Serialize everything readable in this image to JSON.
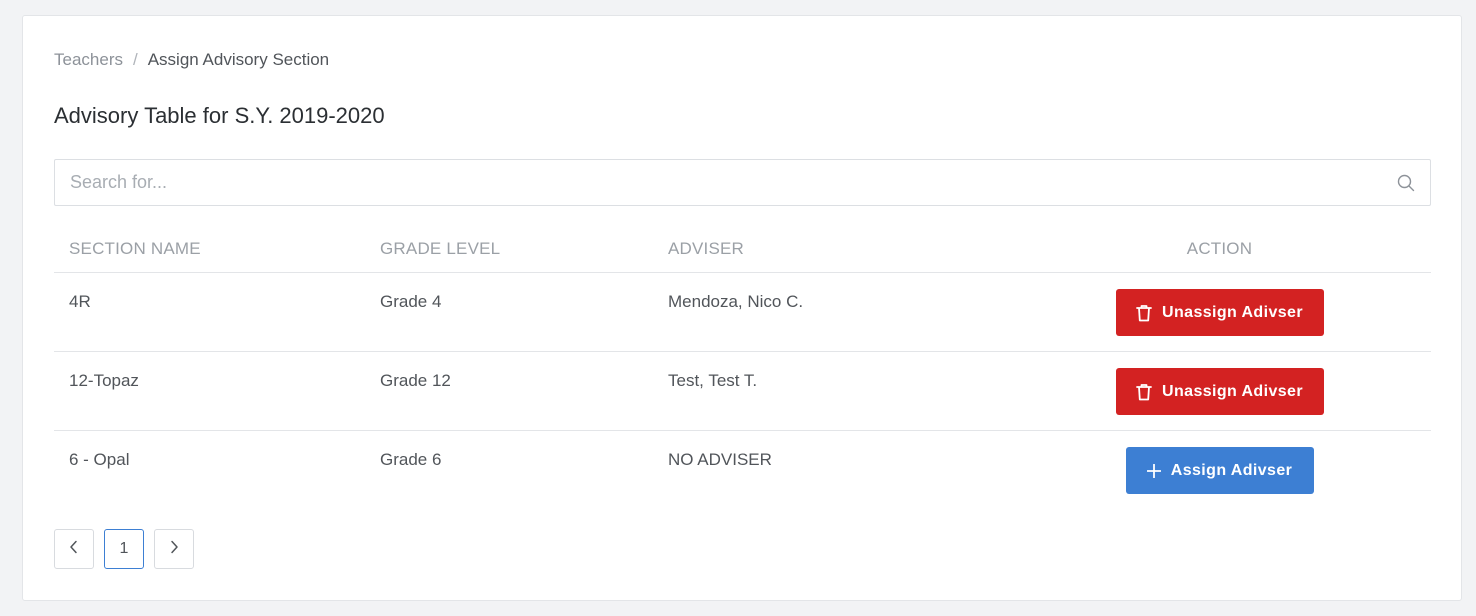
{
  "breadcrumb": {
    "parent": "Teachers",
    "separator": "/",
    "current": "Assign Advisory Section"
  },
  "page_title": "Advisory Table for S.Y. 2019-2020",
  "search": {
    "placeholder": "Search for...",
    "value": "",
    "icon": "search-icon"
  },
  "table": {
    "headers": {
      "section": "SECTION NAME",
      "grade": "GRADE LEVEL",
      "adviser": "ADVISER",
      "action": "ACTION"
    },
    "rows": [
      {
        "section": "4R",
        "grade": "Grade 4",
        "adviser": "Mendoza, Nico C.",
        "action_label": "Unassign Adivser",
        "action_type": "unassign",
        "action_icon": "trash-icon"
      },
      {
        "section": "12-Topaz",
        "grade": "Grade 12",
        "adviser": "Test, Test T.",
        "action_label": "Unassign Adivser",
        "action_type": "unassign",
        "action_icon": "trash-icon"
      },
      {
        "section": "6 - Opal",
        "grade": "Grade 6",
        "adviser": "NO ADVISER",
        "action_label": "Assign Adivser",
        "action_type": "assign",
        "action_icon": "plus-icon"
      }
    ]
  },
  "pagination": {
    "prev_icon": "chevron-left-icon",
    "current_page": "1",
    "next_icon": "chevron-right-icon"
  },
  "colors": {
    "danger": "#d32222",
    "primary": "#3d7fd3",
    "background": "#f2f3f5",
    "card": "#ffffff"
  }
}
